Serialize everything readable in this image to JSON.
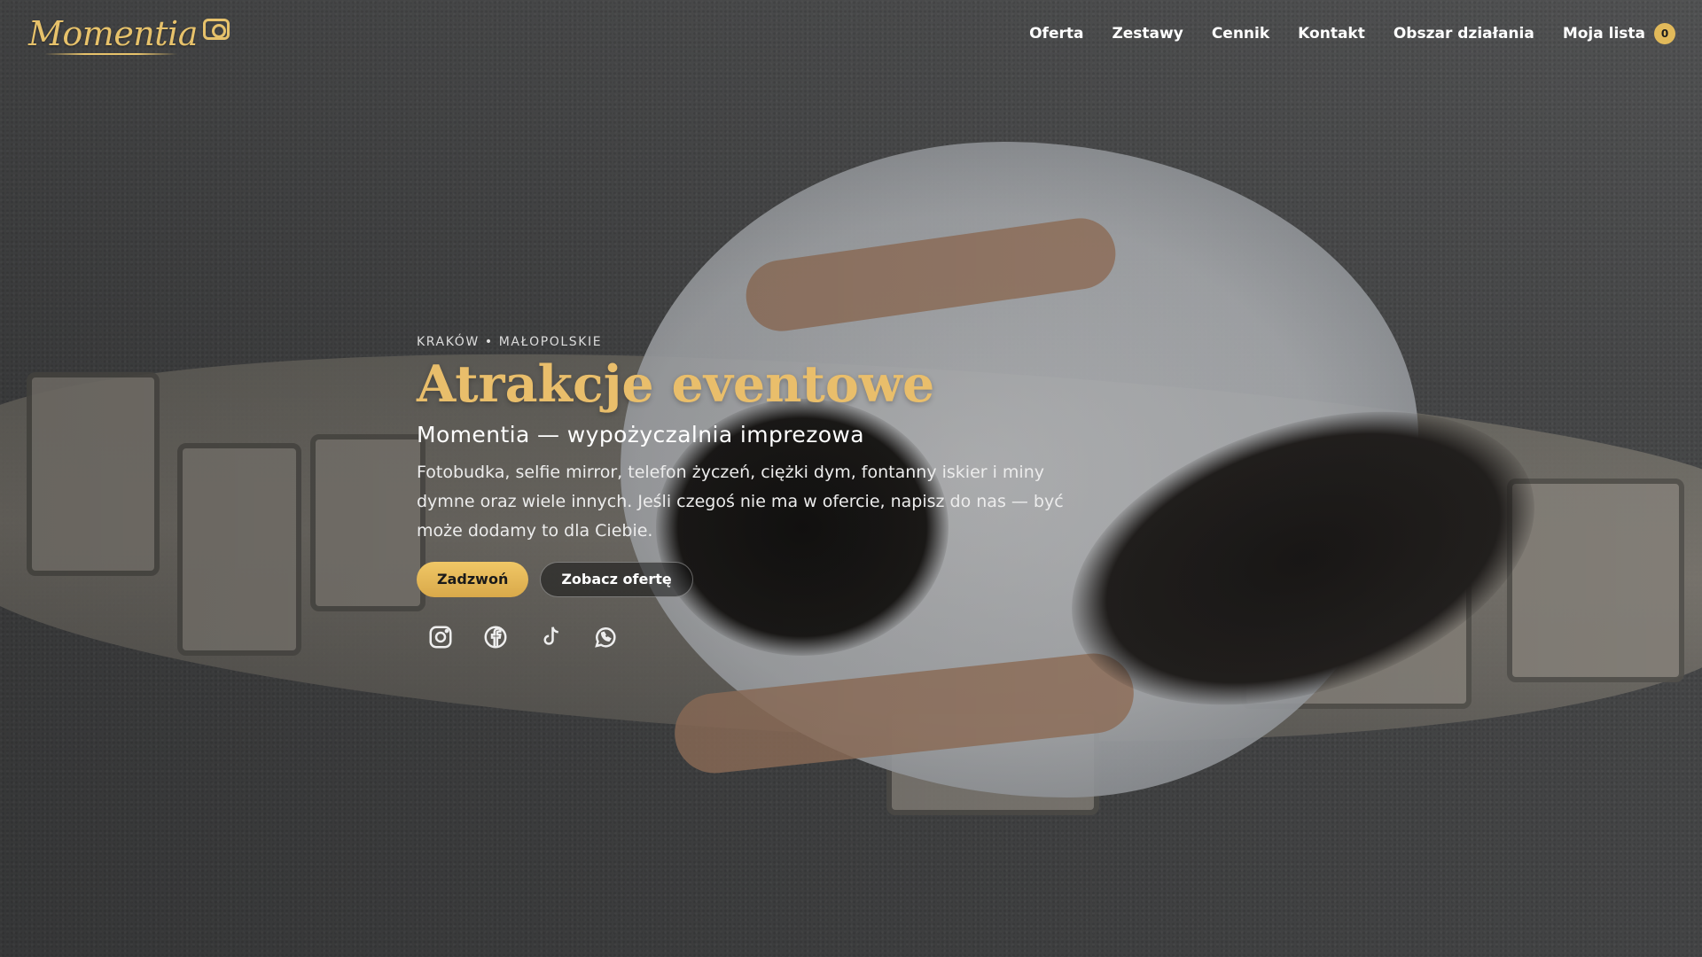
{
  "brand": {
    "name": "Momentia"
  },
  "nav": {
    "items": [
      {
        "label": "Oferta"
      },
      {
        "label": "Zestawy"
      },
      {
        "label": "Cennik"
      },
      {
        "label": "Kontakt"
      },
      {
        "label": "Obszar działania"
      }
    ],
    "list_label": "Moja lista",
    "list_count": "0"
  },
  "hero": {
    "eyebrow": "KRAKÓW • MAŁOPOLSKIE",
    "title": "Atrakcje eventowe",
    "subtitle": "Momentia — wypożyczalnia imprezowa",
    "description": "Fotobudka, selfie mirror, telefon życzeń, ciężki dym, fontanny iskier i miny dymne oraz wiele innych. Jeśli czegoś nie ma w ofercie, napisz do nas — być może dodamy to dla Ciebie.",
    "primary_button": "Zadzwoń",
    "secondary_button": "Zobacz ofertę"
  },
  "socials": [
    "instagram-icon",
    "facebook-icon",
    "tiktok-icon",
    "whatsapp-icon"
  ],
  "colors": {
    "accent": "#e9be6b",
    "badge": "#e1b95a"
  }
}
